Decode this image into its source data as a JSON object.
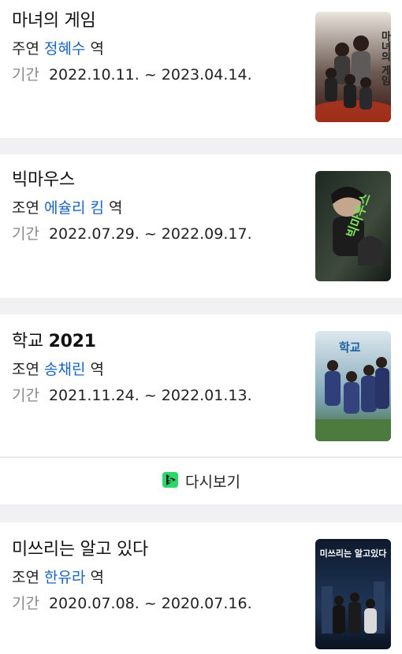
{
  "cards": [
    {
      "title": "마녀의 게임",
      "role_label": "주연",
      "actor": "정혜수",
      "role_suffix": "역",
      "period_label": "기간",
      "period": "2022.10.11. ~ 2023.04.14.",
      "poster_text": "마녀의 게임"
    },
    {
      "title": "빅마우스",
      "role_label": "조연",
      "actor": "에슐리 킴",
      "role_suffix": "역",
      "period_label": "기간",
      "period": "2022.07.29. ~ 2022.09.17.",
      "poster_text": "빅마우스"
    },
    {
      "title_prefix": "학교",
      "title_num": "2021",
      "role_label": "조연",
      "actor": "송채린",
      "role_suffix": "역",
      "period_label": "기간",
      "period": "2021.11.24. ~ 2022.01.13.",
      "poster_text": "학교"
    },
    {
      "title": "미쓰리는 알고 있다",
      "role_label": "조연",
      "actor": "한유라",
      "role_suffix": "역",
      "period_label": "기간",
      "period": "2020.07.08. ~ 2020.07.16.",
      "poster_text": "미쓰리는 알고있다"
    }
  ],
  "rewatch": {
    "label": "다시보기",
    "icon": "play-s-icon",
    "icon_color": "#2bd66b"
  },
  "colors": {
    "link": "#1a63c7",
    "muted": "#888888",
    "page_bg": "#f1f1f3"
  }
}
